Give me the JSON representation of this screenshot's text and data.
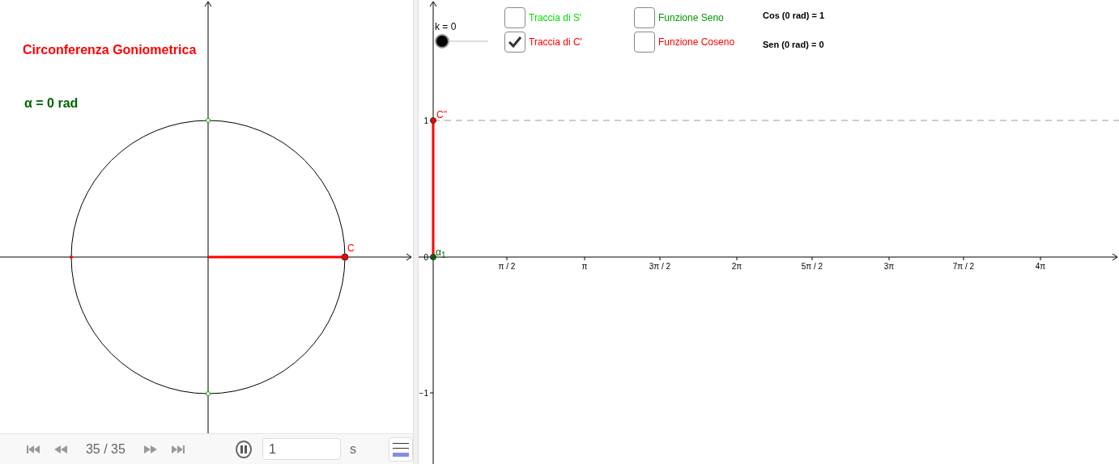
{
  "left_view": {
    "title": "Circonferenza Goniometrica",
    "angle_label": "α = 0 rad",
    "point_label": "C"
  },
  "right_view": {
    "slider": {
      "label": "k = 0",
      "level": 0
    },
    "checkboxes": [
      {
        "label": "Traccia di S'",
        "checked": false,
        "color": "#00dd00"
      },
      {
        "label": "Funzione Seno",
        "checked": false,
        "color": "#009900"
      },
      {
        "label": "Traccia di C'",
        "checked": true,
        "color": "#ff0000"
      },
      {
        "label": "Funzione Coseno",
        "checked": false,
        "color": "#ff0000"
      }
    ],
    "readouts": [
      "Cos (0 rad) = 1",
      "Sen (0 rad) = 0"
    ],
    "y_ticks": [
      "1",
      "0",
      "−1"
    ],
    "x_ticks": [
      "π / 2",
      "π",
      "3π / 2",
      "2π",
      "5π / 2",
      "3π",
      "7π / 2",
      "4π"
    ],
    "point_c_label": "C\"",
    "origin_label": "α$_{1}$"
  },
  "playback": {
    "counter": "35 / 35",
    "playing": true,
    "speed": "1",
    "unit": "s"
  }
}
